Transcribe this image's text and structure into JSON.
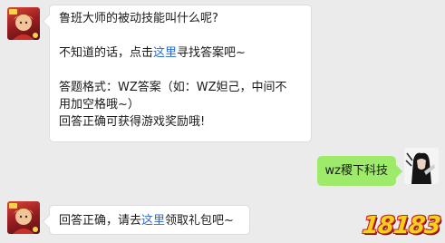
{
  "messages": [
    {
      "type": "received",
      "paragraphs": [
        {
          "segments": [
            {
              "text": "鲁班大师的被动技能叫什么呢?"
            }
          ]
        },
        {
          "gap": true
        },
        {
          "segments": [
            {
              "text": "不知道的话，点击"
            },
            {
              "text": "这里",
              "link": true
            },
            {
              "text": "寻找答案吧~"
            }
          ]
        },
        {
          "gap": true
        },
        {
          "segments": [
            {
              "text": "答题格式：WZ答案（如：WZ妲己，中间不"
            }
          ]
        },
        {
          "segments": [
            {
              "text": "用加空格哦~）"
            }
          ]
        },
        {
          "segments": [
            {
              "text": "回答正确可获得游戏奖励哦!"
            }
          ]
        }
      ]
    },
    {
      "type": "sent",
      "text": "wz稷下科技"
    },
    {
      "type": "received",
      "segments": [
        {
          "text": "回答正确，请去"
        },
        {
          "text": "这里",
          "link": true
        },
        {
          "text": "领取礼包吧~"
        }
      ]
    }
  ],
  "watermark": "18183",
  "colors": {
    "background": "#ebebeb",
    "received_bubble": "#ffffff",
    "sent_bubble": "#9eea6a",
    "link": "#2a6ad4",
    "watermark_fill": "#f6d01c",
    "watermark_outline": "#c6252a"
  },
  "icons": {
    "received_avatar": "game-character-avatar-icon",
    "sent_avatar": "user-avatar-icon"
  }
}
